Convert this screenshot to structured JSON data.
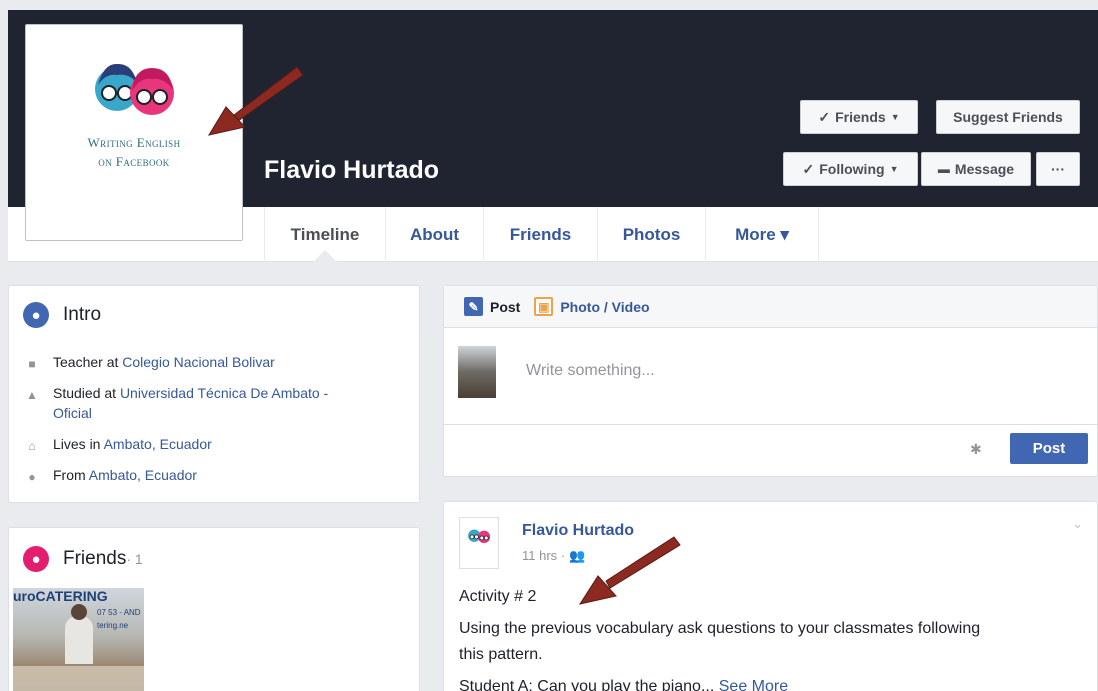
{
  "profile": {
    "name": "Flavio Hurtado",
    "logo_line1": "Writing English",
    "logo_line2": "on Facebook"
  },
  "cover_buttons": {
    "friends": "Friends",
    "suggest_friends": "Suggest Friends",
    "following": "Following",
    "message": "Message",
    "more": "···"
  },
  "tabs": [
    {
      "label": "Timeline",
      "active": true
    },
    {
      "label": "About"
    },
    {
      "label": "Friends"
    },
    {
      "label": "Photos"
    },
    {
      "label": "More ▾"
    }
  ],
  "intro": {
    "title": "Intro",
    "items": [
      {
        "prefix": "Teacher at ",
        "link": "Colegio Nacional Bolivar",
        "icon": "briefcase-icon"
      },
      {
        "prefix": "Studied at ",
        "link": "Universidad Técnica De Ambato -",
        "link2": "Oficial",
        "icon": "graduation-cap-icon"
      },
      {
        "prefix": "Lives in ",
        "link": "Ambato, Ecuador",
        "icon": "home-icon"
      },
      {
        "prefix": "From ",
        "link": "Ambato, Ecuador",
        "icon": "location-pin-icon"
      }
    ]
  },
  "friends_box": {
    "title": "Friends",
    "count": "· 1",
    "thumb_text": "uroCATERING",
    "thumb_text2": "07 53 - AND",
    "thumb_text3": "tering.ne"
  },
  "composer": {
    "tab_post": "Post",
    "tab_photo": "Photo / Video",
    "placeholder": "Write something...",
    "post_button": "Post"
  },
  "feed_post": {
    "author": "Flavio Hurtado",
    "time": "11 hrs ·",
    "line1": "Activity # 2",
    "line2": "Using the previous vocabulary ask questions to your classmates following",
    "line3": "this pattern.",
    "line4_prefix": "Student A: Can you play the piano...",
    "see_more": "See More"
  },
  "colors": {
    "cover": "#1f2430",
    "link": "#365899",
    "button_blue": "#4267b2",
    "intro_icon": "#4267b2",
    "friends_icon": "#e41e6f",
    "arrow": "#8c2a22"
  }
}
